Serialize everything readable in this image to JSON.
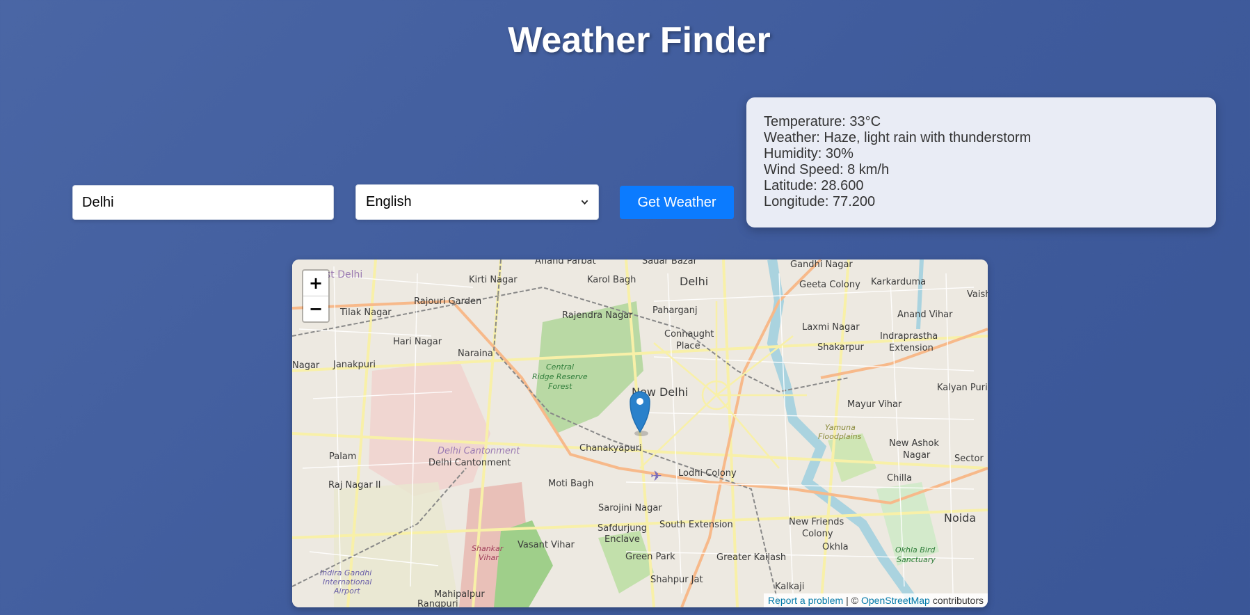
{
  "page": {
    "title": "Weather Finder"
  },
  "form": {
    "city_value": "Delhi",
    "language_selected": "English",
    "get_button_label": "Get Weather"
  },
  "weather": {
    "temperature": "Temperature: 33°C",
    "conditions": "Weather: Haze, light rain with thunderstorm",
    "humidity": "Humidity: 30%",
    "wind_speed": "Wind Speed: 8 km/h",
    "latitude": "Latitude: 28.600",
    "longitude": "Longitude: 77.200"
  },
  "map": {
    "zoom_in_label": "+",
    "zoom_out_label": "−",
    "attribution": {
      "report_link": "Report a problem",
      "separator": "| ©",
      "osm_link": "OpenStreetMap",
      "suffix": "contributors"
    },
    "places": {
      "anand_parbat": "Anand Parbat",
      "sadar_bazar": "Sadar Bazar",
      "gandhi_nagar": "Gandhi Nagar",
      "west_delhi": "st Delhi",
      "kirti_nagar": "Kirti Nagar",
      "karol_bagh": "Karol Bagh",
      "delhi": "Delhi",
      "geeta_colony": "Geeta Colony",
      "karkarduma": "Karkarduma",
      "vaish": "Vaish",
      "rajouri_garden": "Rajouri Garden",
      "tilak_nagar": "Tilak Nagar",
      "paharganj": "Paharganj",
      "anand_vihar": "Anand Vihar",
      "rajendra_nagar": "Rajendra Nagar",
      "laxmi_nagar": "Laxmi Nagar",
      "hari_nagar": "Hari Nagar",
      "connaught_1": "Connaught",
      "connaught_2": "Place",
      "indraprastha_1": "Indraprastha",
      "indraprastha_2": "Extension",
      "shakarpur": "Shakarpur",
      "naraina": "Naraina",
      "janakpuri": "Janakpuri",
      "nagar_left": "Nagar",
      "ridge_1": "Central",
      "ridge_2": "Ridge Reserve",
      "ridge_3": "Forest",
      "new_delhi": "New Delhi",
      "kalyan_puri": "Kalyan Puri",
      "mayur_vihar": "Mayur Vihar",
      "yamuna_1": "Yamuna",
      "yamuna_2": "Floodplains",
      "chanakyapuri": "Chanakyapuri",
      "new_ashok_1": "New Ashok",
      "new_ashok_2": "Nagar",
      "sector": "Sector",
      "delhi_cant_italic": "Delhi Cantonment",
      "palam": "Palam",
      "delhi_cant": "Delhi Cantonment",
      "lodhi_colony": "Lodhi Colony",
      "chilla": "Chilla",
      "raj_nagar": "Raj Nagar II",
      "moti_bagh": "Moti Bagh",
      "sarojini_nagar": "Sarojini Nagar",
      "noida": "Noida",
      "new_friends_1": "New Friends",
      "new_friends_2": "Colony",
      "safdarjung_1": "Safdurjung",
      "safdarjung_2": "Enclave",
      "south_extension": "South Extension",
      "vasant_vihar": "Vasant Vihar",
      "okhla": "Okhla",
      "shankar_1": "Shankar",
      "shankar_2": "Vihar",
      "okhla_bird_1": "Okhla Bird",
      "okhla_bird_2": "Sanctuary",
      "green_park": "Green Park",
      "greater_kailash": "Greater Kailash",
      "igi_1": "Indira Gandhi",
      "igi_2": "International",
      "igi_3": "Airport",
      "shahpur_jat": "Shahpur Jat",
      "kalkaji": "Kalkaji",
      "mahipalpur": "Mahipalpur",
      "rangpuri": "Rangpuri"
    }
  },
  "colors": {
    "background": "#4561a1",
    "button": "#0b7bff",
    "card": "#e9ecf5",
    "marker": "#2a81cb"
  }
}
